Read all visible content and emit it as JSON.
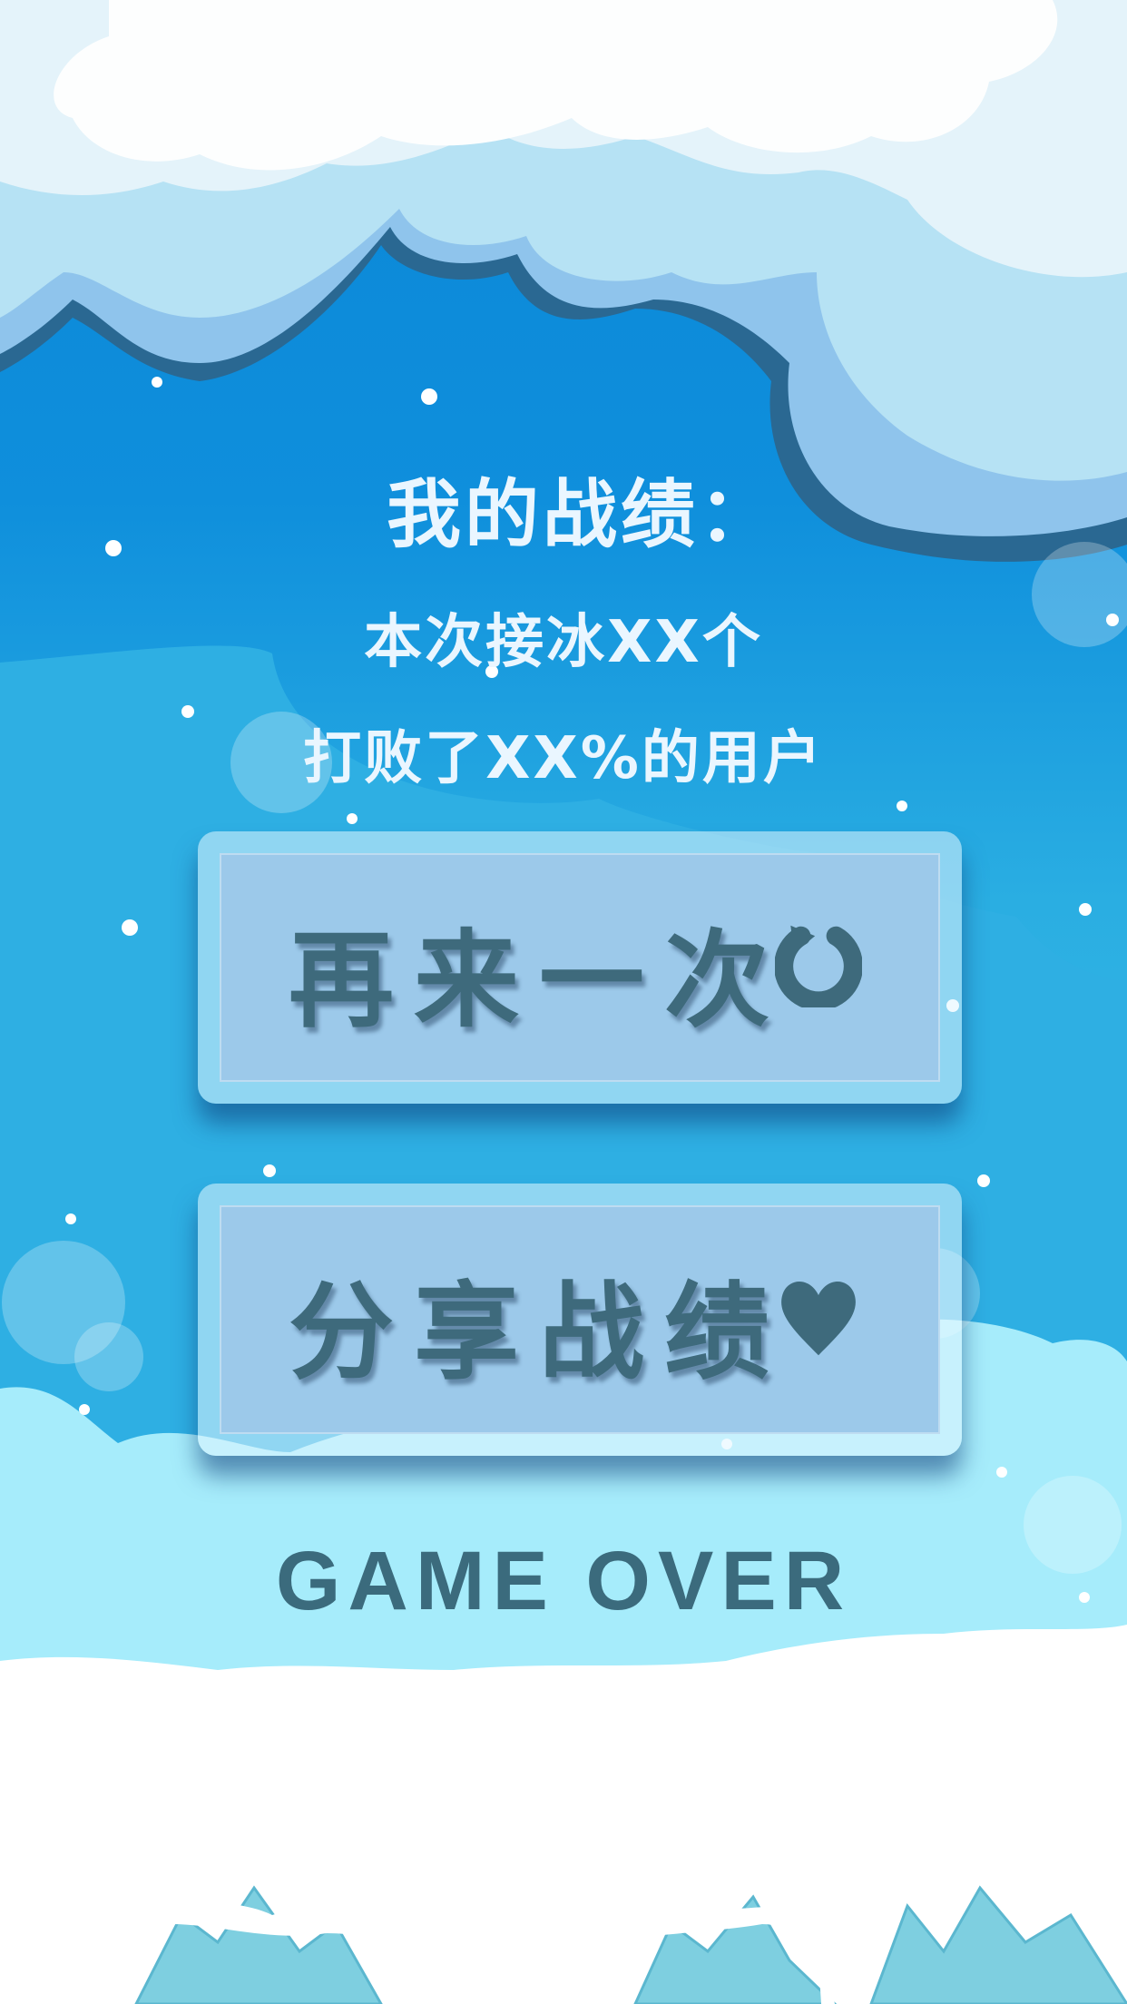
{
  "result": {
    "title": "我的战绩：",
    "catch_count": "本次接冰XX个",
    "beat_percent": "打败了XX%的用户"
  },
  "buttons": {
    "retry_label": "再来一次",
    "retry_icon": "refresh-icon",
    "share_label": "分享战绩",
    "share_icon": "heart-icon"
  },
  "footer": {
    "game_over": "GAME OVER"
  },
  "colors": {
    "sky_top": "#0a86d6",
    "sky_bottom": "#a9ebfb",
    "cloud_light": "#e6f4fb",
    "button_fill": "#9cc9ea",
    "button_text": "#3e6a7c"
  }
}
